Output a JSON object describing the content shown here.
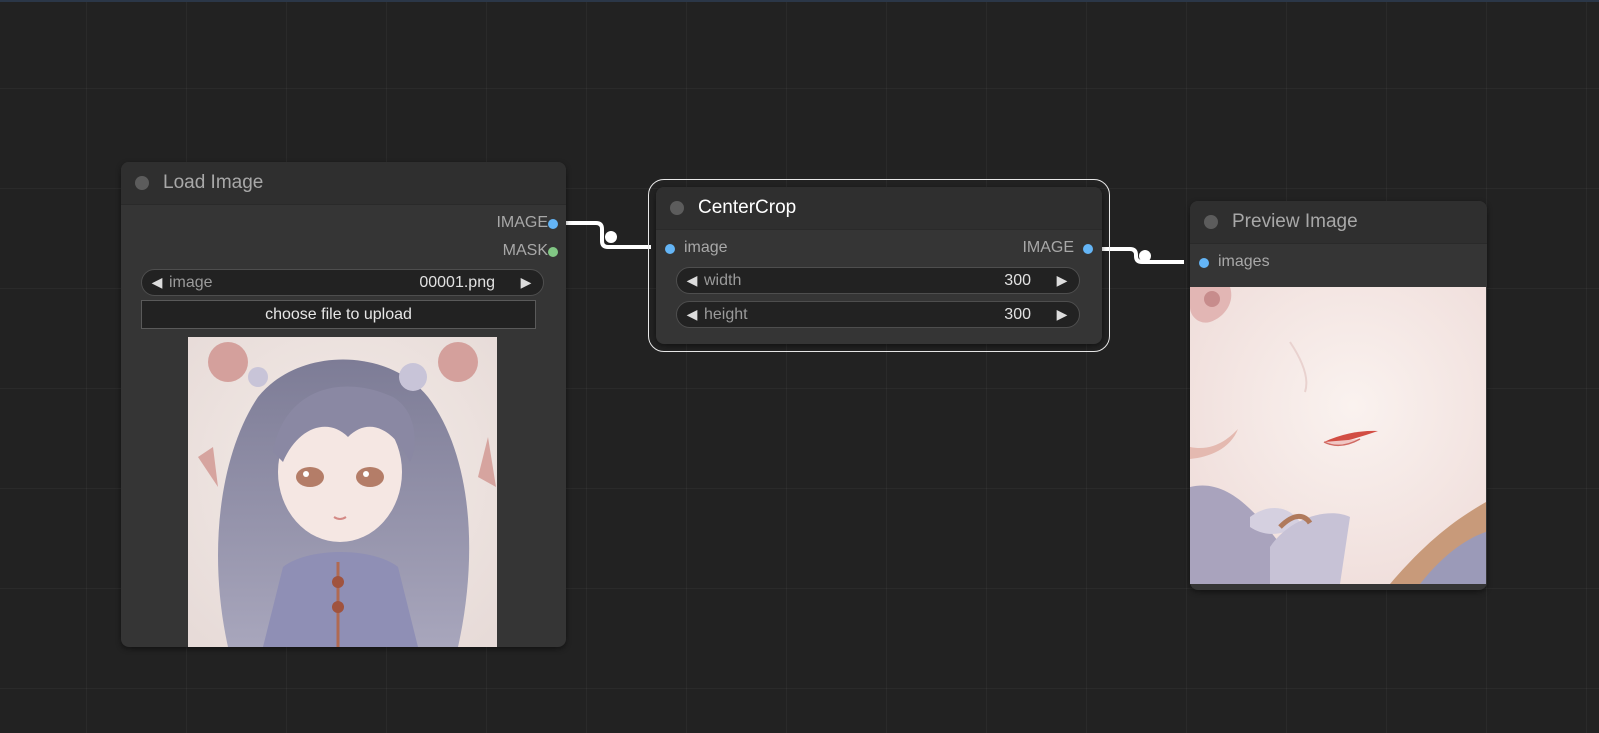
{
  "canvas": {
    "background": "#222222"
  },
  "nodes": {
    "load_image": {
      "title": "Load Image",
      "outputs": [
        {
          "label": "IMAGE",
          "color": "#64b5f6"
        },
        {
          "label": "MASK",
          "color": "#81c784"
        }
      ],
      "image_widget": {
        "label": "image",
        "value": "00001.png"
      },
      "upload_label": "choose file to upload"
    },
    "center_crop": {
      "title": "CenterCrop",
      "input": {
        "label": "image",
        "color": "#64b5f6"
      },
      "output": {
        "label": "IMAGE",
        "color": "#64b5f6"
      },
      "width": {
        "label": "width",
        "value": "300"
      },
      "height": {
        "label": "height",
        "value": "300"
      }
    },
    "preview_image": {
      "title": "Preview Image",
      "input": {
        "label": "images",
        "color": "#64b5f6"
      }
    }
  },
  "link_color": "#ffffff"
}
